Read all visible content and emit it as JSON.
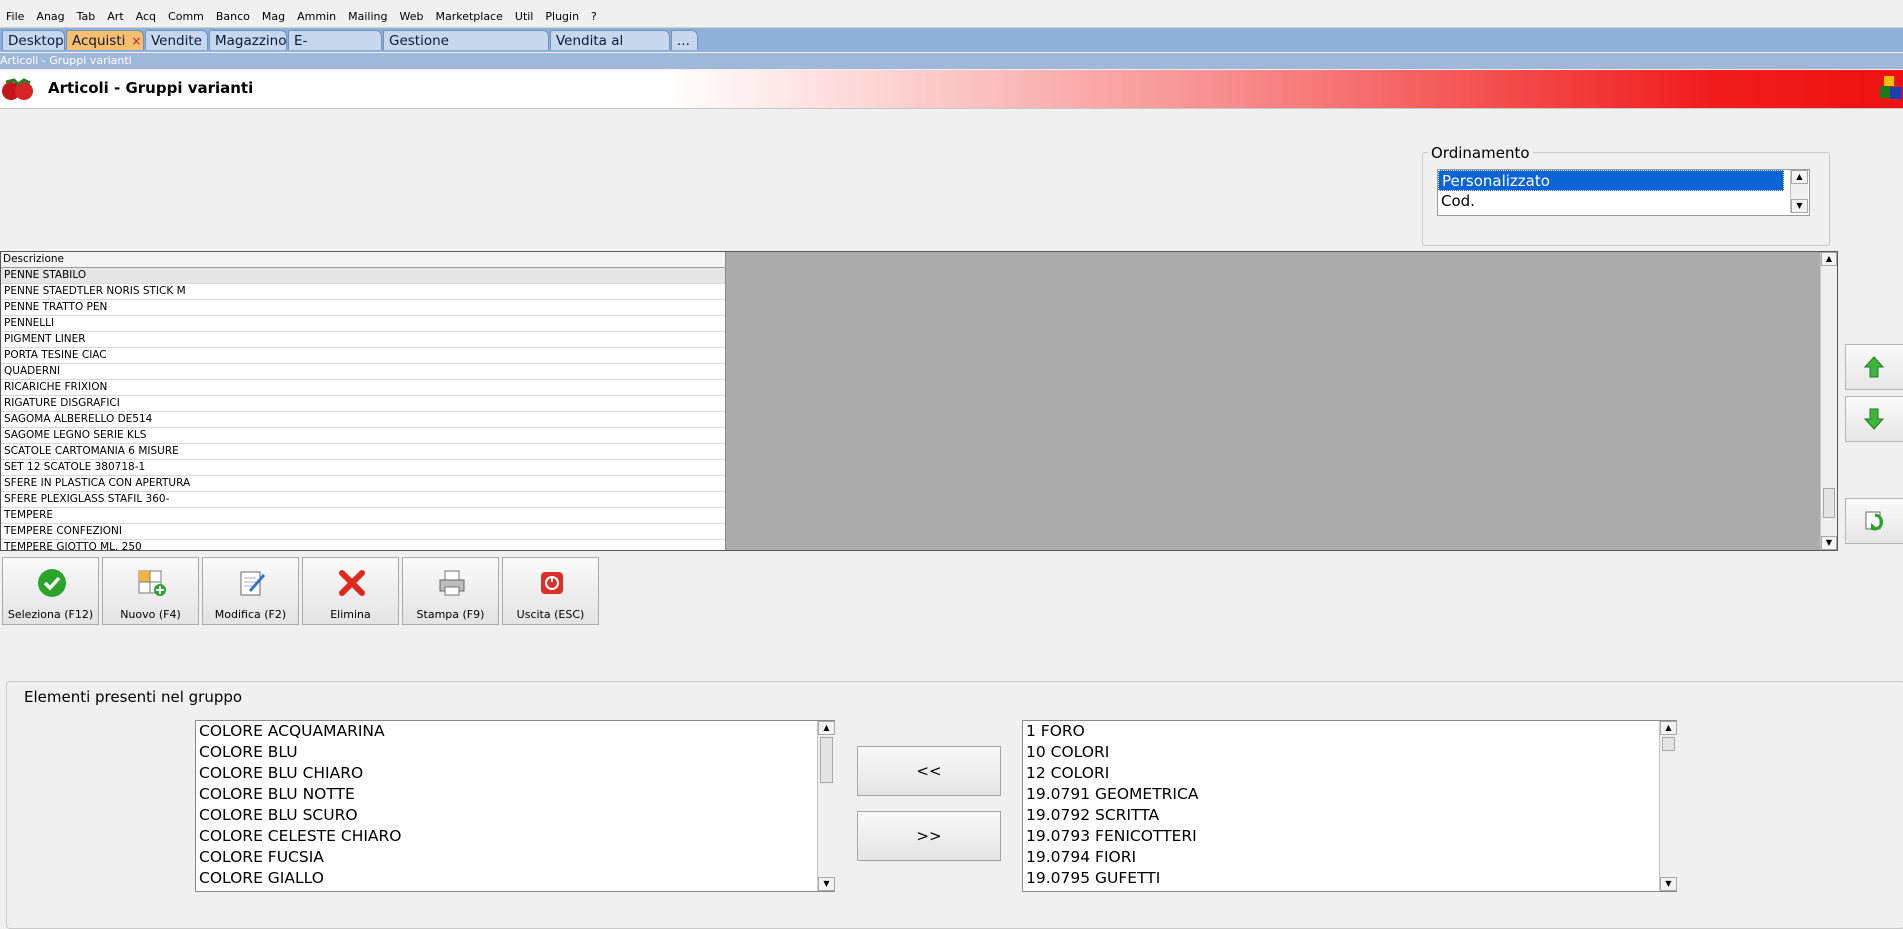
{
  "menu": [
    "File",
    "Anag",
    "Tab",
    "Art",
    "Acq",
    "Comm",
    "Banco",
    "Mag",
    "Ammin",
    "Mailing",
    "Web",
    "Marketplace",
    "Util",
    "Plugin",
    "?"
  ],
  "tabs": {
    "desktop": "Desktop",
    "acquisti": "Acquisti",
    "close": "×",
    "vendite": "Vendite",
    "magazzino": "Magazzino",
    "ecommerce": "E-Commerce",
    "messaggistica": "Gestione messaggistica",
    "vendita_banco": "Vendita al banco",
    "more": "..."
  },
  "window_title": "Articoli - Gruppi varianti",
  "header_title": "Articoli - Gruppi varianti",
  "ordinamento": {
    "legend": "Ordinamento",
    "options": [
      "Personalizzato",
      "Cod."
    ],
    "selected": "Personalizzato"
  },
  "table": {
    "header": "Descrizione",
    "rows": [
      "PENNE STABILO",
      "PENNE STAEDTLER NORIS STICK M",
      "PENNE TRATTO PEN",
      "PENNELLI",
      "PIGMENT LINER",
      "PORTA TESINE CIAC",
      "QUADERNI",
      "RICARICHE FRIXION",
      "RIGATURE DISGRAFICI",
      "SAGOMA ALBERELLO DE514",
      "SAGOME LEGNO SERIE KLS",
      "SCATOLE CARTOMANIA 6 MISURE",
      "SET 12 SCATOLE 380718-1",
      "SFERE IN PLASTICA CON APERTURA",
      "SFERE PLEXIGLASS STAFIL 360-",
      "TEMPERE",
      "TEMPERE CONFEZIONI",
      "TEMPERE GIOTTO ML. 250"
    ],
    "selected_row": "PENNE STABILO"
  },
  "toolbar": {
    "seleziona": "Seleziona (F12)",
    "nuovo": "Nuovo (F4)",
    "modifica": "Modifica (F2)",
    "elimina": "Elimina",
    "stampa": "Stampa (F9)",
    "uscita": "Uscita (ESC)"
  },
  "group": {
    "legend": "Elementi presenti nel gruppo",
    "left_items": [
      "COLORE ACQUAMARINA",
      "COLORE BLU",
      "COLORE BLU CHIARO",
      "COLORE BLU NOTTE",
      "COLORE BLU SCURO",
      "COLORE CELESTE CHIARO",
      "COLORE FUCSIA",
      "COLORE GIALLO"
    ],
    "right_items": [
      "1 FORO",
      "10 COLORI",
      "12 COLORI",
      "19.0791 GEOMETRICA",
      "19.0792 SCRITTA",
      "19.0793 FENICOTTERI",
      "19.0794 FIORI",
      "19.0795 GUFETTI"
    ],
    "move_left": "<<",
    "move_right": ">>"
  },
  "colors": {
    "tab_bar": "#8fb0d9",
    "tab_active": "#f6bf70",
    "header_gradient_end": "#ee1111",
    "selection": "#0a64d6"
  }
}
